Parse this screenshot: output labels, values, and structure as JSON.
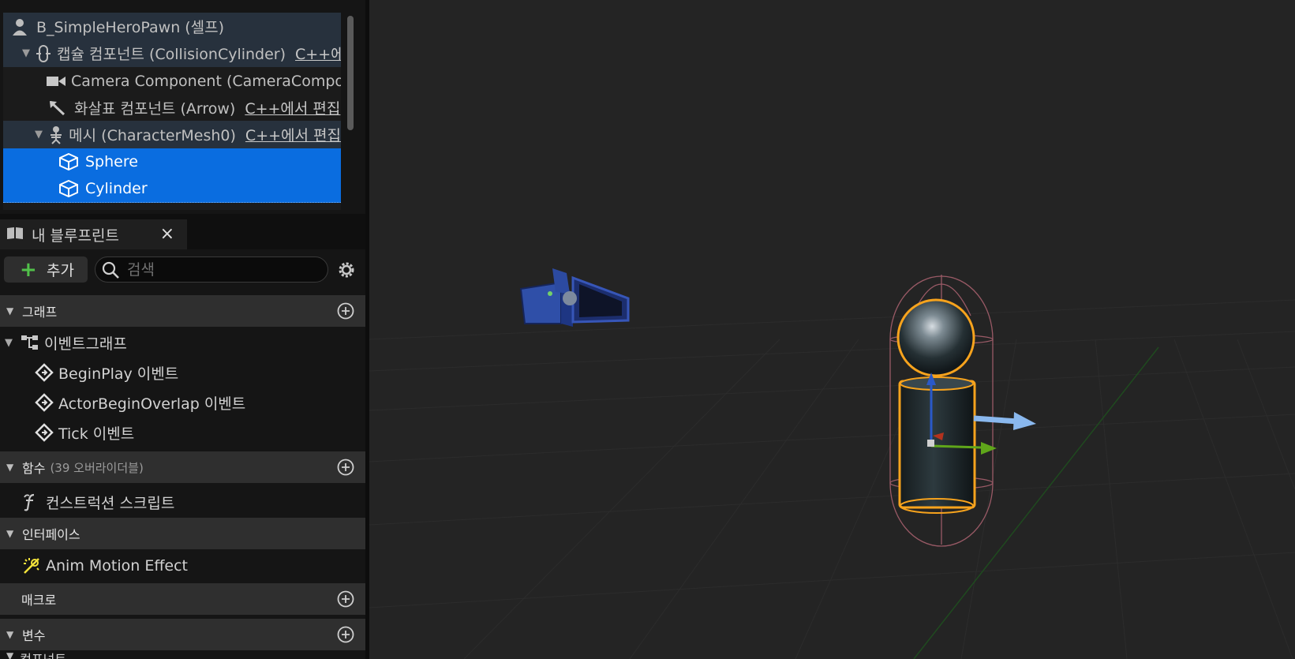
{
  "components": {
    "items": [
      {
        "label": "B_SimpleHeroPawn (셀프)",
        "tag": ""
      },
      {
        "label": "캡슐 컴포넌트 (CollisionCylinder)",
        "tag": "C++에"
      },
      {
        "label": "Camera Component (CameraCompone",
        "tag": ""
      },
      {
        "label": "화살표 컴포넌트 (Arrow)",
        "tag": "C++에서 편집"
      },
      {
        "label": "메시 (CharacterMesh0)",
        "tag": "C++에서 편집"
      },
      {
        "label": "Sphere",
        "tag": ""
      },
      {
        "label": "Cylinder",
        "tag": ""
      }
    ]
  },
  "my_blueprint": {
    "tab_title": "내 블루프린트",
    "close_glyph": "×",
    "add_label": "추가",
    "search_placeholder": "검색",
    "sections": {
      "graphs": {
        "title": "그래프"
      },
      "functions": {
        "title": "함수",
        "subtitle": "(39 오버라이더블)"
      },
      "interfaces": {
        "title": "인터페이스"
      },
      "macros": {
        "title": "매크로"
      },
      "variables": {
        "title": "변수"
      },
      "components": {
        "title": "컴포넌트"
      }
    },
    "event_graph": {
      "label": "이벤트그래프",
      "events": [
        "BeginPlay 이벤트",
        "ActorBeginOverlap 이벤트",
        "Tick 이벤트"
      ]
    },
    "construction_script": "컨스트럭션 스크립트",
    "interface_item": "Anim Motion Effect"
  },
  "colors": {
    "selection": "#0a6de0",
    "selection_outline": "#f7a31d",
    "capsule_wire": "#9a5a66",
    "arrow_blue": "#8ab8ee",
    "gizmo_green": "#5fa61a"
  }
}
